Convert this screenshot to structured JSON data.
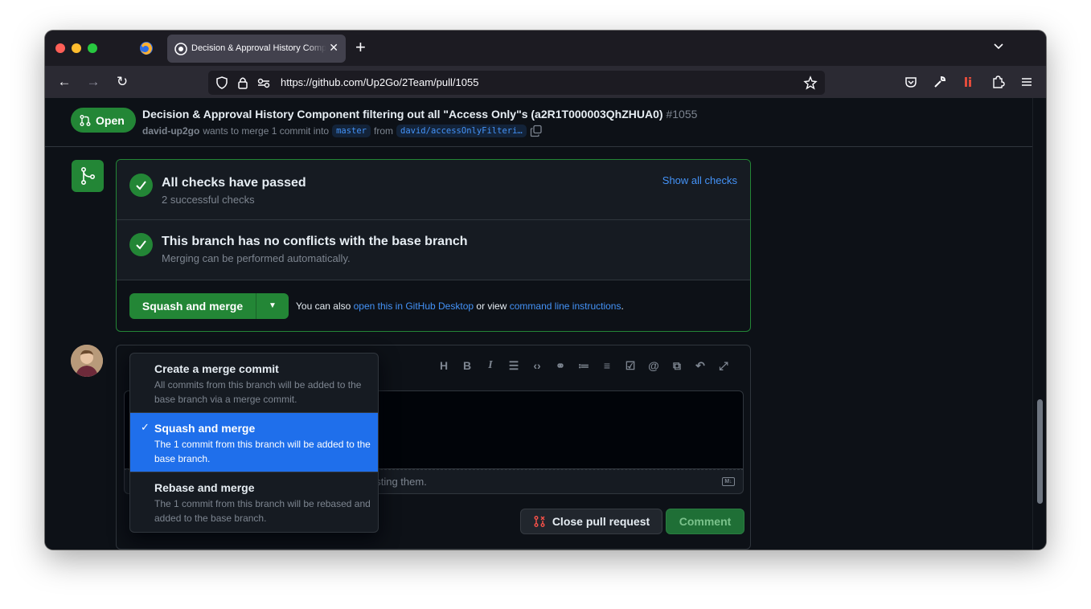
{
  "browser": {
    "tab": {
      "title": "Decision & Approval History Component filtering out all \"Access Only\"s"
    },
    "url": "https://github.com/Up2Go/2Team/pull/1055",
    "icons": [
      "firefox-icon",
      "github-favicon",
      "close-icon",
      "new-tab-icon",
      "tab-list-icon",
      "back-icon",
      "forward-icon",
      "reload-icon",
      "shield-icon",
      "lock-icon",
      "permissions-icon",
      "bookmark-star-icon",
      "pocket-icon",
      "wrench-icon",
      "extension-icon",
      "puzzle-icon",
      "menu-icon"
    ]
  },
  "pr": {
    "state": "Open",
    "title": "Decision & Approval History Component filtering out all \"Access Only\"s (a2R1T000003QhZHUA0)",
    "number": "#1055",
    "author": "david-up2go",
    "merge_text": "wants to merge 1 commit into",
    "base_branch": "master",
    "from_text": "from",
    "head_branch": "david/accessOnlyFilteri…"
  },
  "merge_box": {
    "checks_title": "All checks have passed",
    "checks_sub": "2 successful checks",
    "show_all_checks": "Show all checks",
    "conflicts_title": "This branch has no conflicts with the base branch",
    "conflicts_sub": "Merging can be performed automatically.",
    "merge_button": "Squash and merge",
    "also_prefix": "You can also",
    "desktop_link": "open this in GitHub Desktop",
    "or_view": "or view",
    "cli_link": "command line instructions",
    "period": "."
  },
  "dropdown": {
    "items": [
      {
        "title": "Create a merge commit",
        "desc": "All commits from this branch will be added to the base branch via a merge commit.",
        "selected": false
      },
      {
        "title": "Squash and merge",
        "desc": "The 1 commit from this branch will be added to the base branch.",
        "selected": true
      },
      {
        "title": "Rebase and merge",
        "desc": "The 1 commit from this branch will be rebased and added to the base branch.",
        "selected": false
      }
    ]
  },
  "comment": {
    "toolbar_icons": [
      "heading-icon",
      "bold-icon",
      "italic-icon",
      "quote-icon",
      "code-icon",
      "link-icon",
      "unordered-list-icon",
      "ordered-list-icon",
      "task-list-icon",
      "mention-icon",
      "reference-icon",
      "reply-icon",
      "fullscreen-icon"
    ],
    "attach_text": "asting them.",
    "close_button": "Close pull request",
    "comment_button": "Comment"
  },
  "colors": {
    "page_bg": "#0d1117",
    "success": "#238636",
    "link": "#4493f8",
    "selected": "#1f6feb",
    "border": "#30363d"
  }
}
